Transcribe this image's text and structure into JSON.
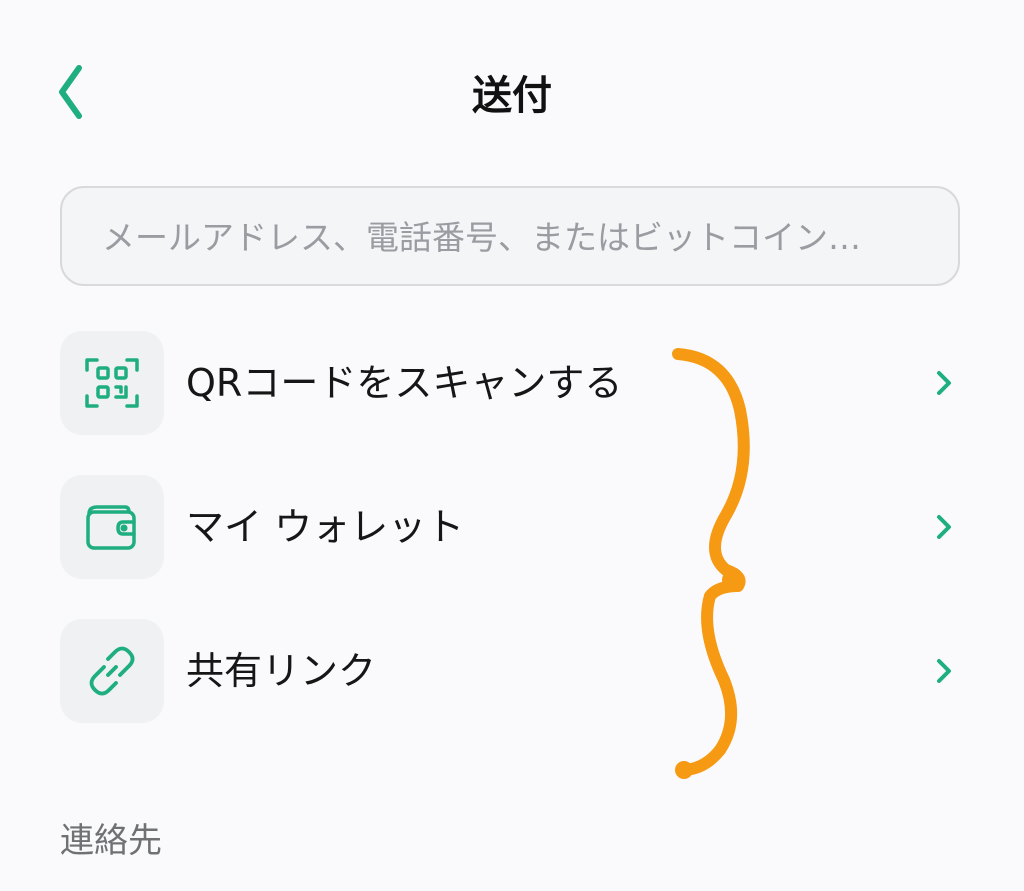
{
  "header": {
    "title": "送付",
    "back_icon": "chevron-left-icon"
  },
  "search": {
    "placeholder": "メールアドレス、電話番号、またはビットコイン…",
    "value": ""
  },
  "options": [
    {
      "label": "QRコードをスキャンする",
      "icon": "qr-scan-icon"
    },
    {
      "label": "マイ ウォレット",
      "icon": "wallet-icon"
    },
    {
      "label": "共有リンク",
      "icon": "link-icon"
    }
  ],
  "contacts": {
    "section_label": "連絡先"
  },
  "colors": {
    "accent": "#1fae7f",
    "annotation": "#f59a12",
    "background": "#fafafc"
  }
}
